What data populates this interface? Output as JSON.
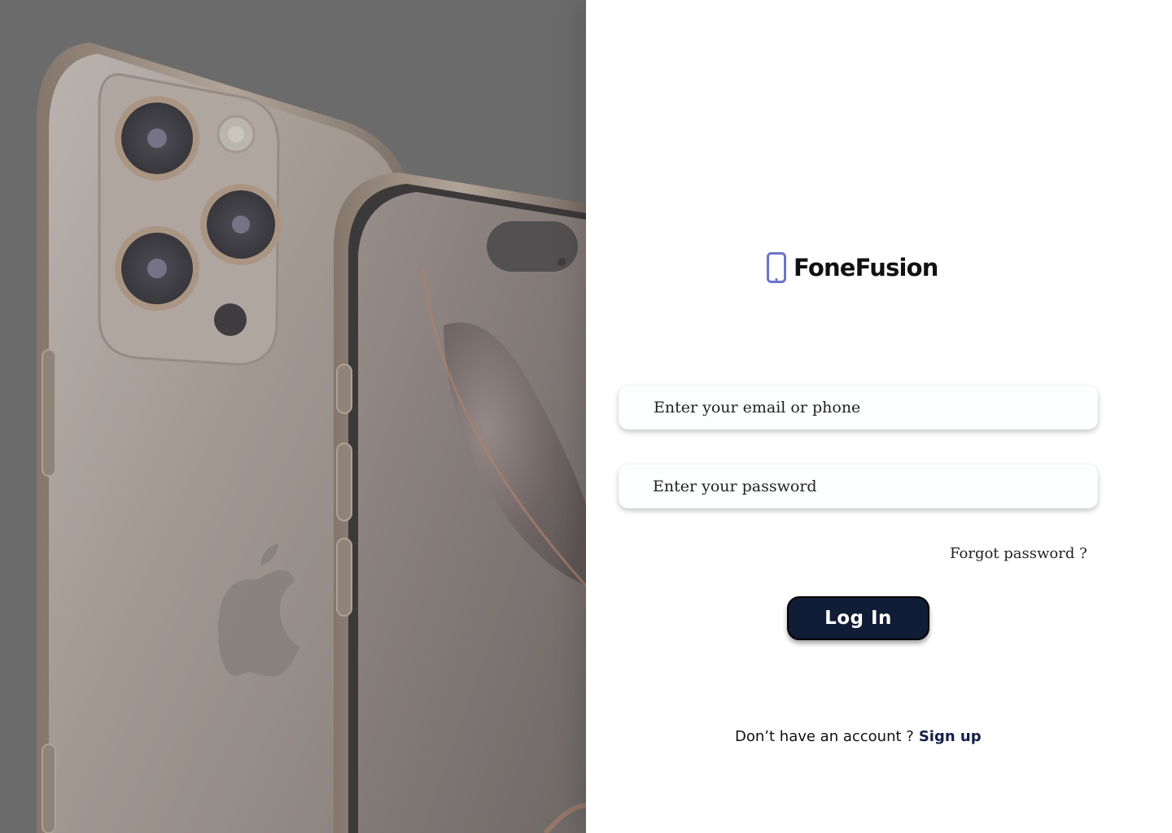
{
  "brand": {
    "name": "FoneFusion",
    "icon": "smartphone-icon",
    "icon_color": "#6b75c9"
  },
  "hero": {
    "image": "two-smartphones-product-photo",
    "overlay_color": "#6b6b6b"
  },
  "login_form": {
    "email_placeholder": "Enter your email or phone",
    "password_placeholder": "Enter your password",
    "forgot_password": "Forgot password ?",
    "submit_label": "Log In"
  },
  "signup": {
    "prompt": "Don’t have an account ?",
    "link_label": "Sign up"
  },
  "colors": {
    "button_bg": "#111c36",
    "link": "#132048",
    "text": "#222222"
  }
}
